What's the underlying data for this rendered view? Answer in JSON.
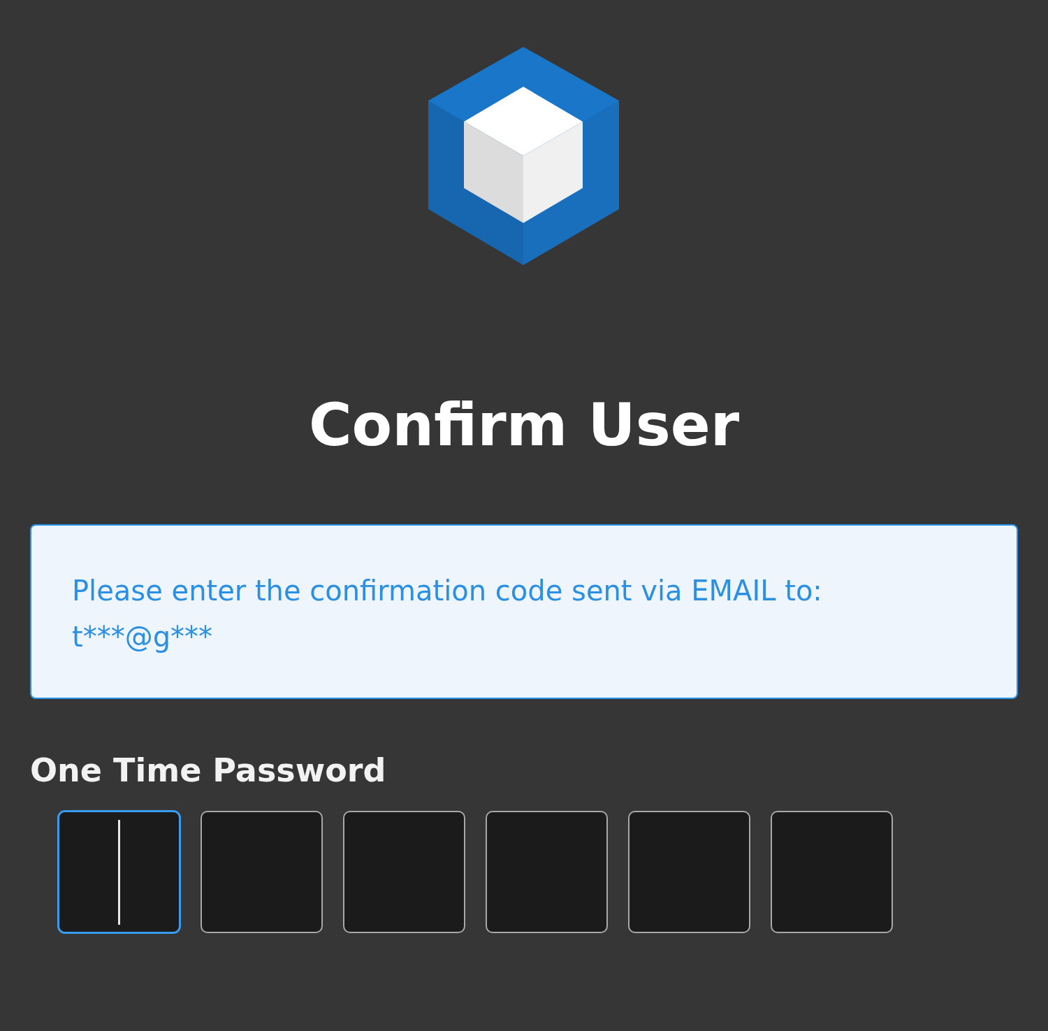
{
  "title": "Confirm User",
  "info": {
    "message": "Please enter the confirmation code sent via EMAIL to:",
    "address": "t***@g***"
  },
  "otp": {
    "label": "One Time Password",
    "digits": [
      {
        "focused": true
      },
      {
        "focused": false
      },
      {
        "focused": false
      },
      {
        "focused": false
      },
      {
        "focused": false
      },
      {
        "focused": false
      }
    ]
  }
}
